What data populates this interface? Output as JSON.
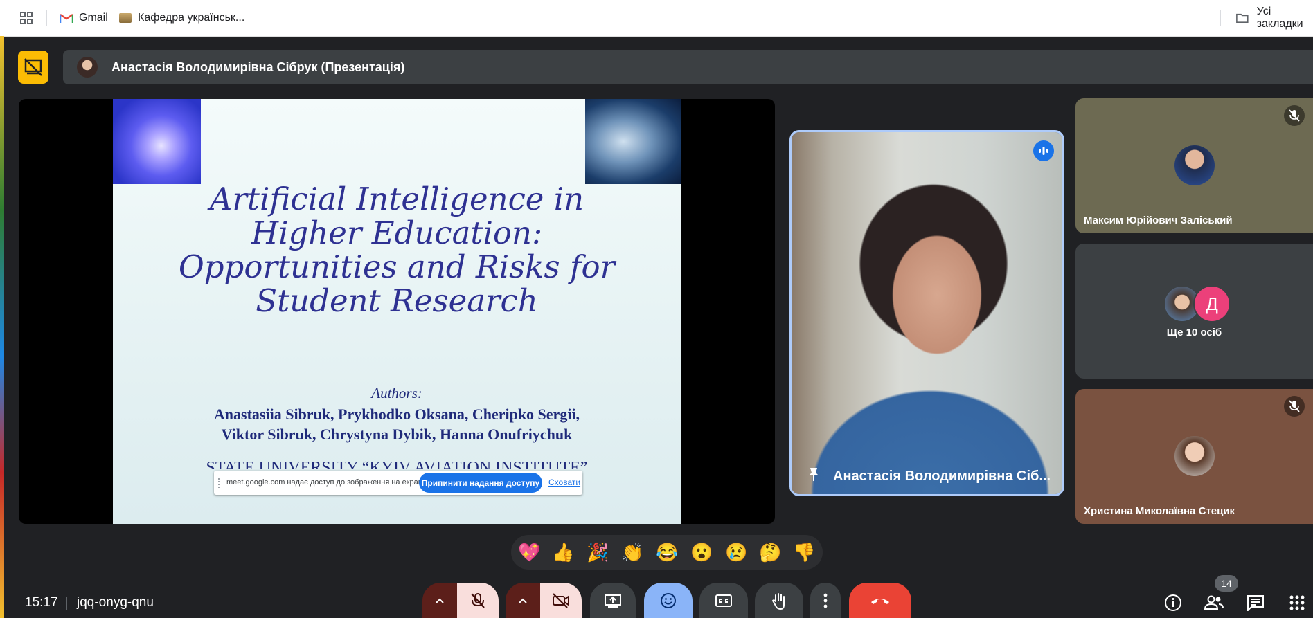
{
  "bookmarks": {
    "gmail": "Gmail",
    "kafedra": "Кафедра українськ...",
    "all_bookmarks": "Усі закладки"
  },
  "presenter": {
    "name": "Анастасія Володимирівна Сібрук (Презентація)"
  },
  "slide": {
    "title_lines": [
      "Artificial Intelligence in",
      "Higher Education:",
      "Opportunities and Risks for",
      "Student Research"
    ],
    "authors_heading": "Authors:",
    "authors_lines": [
      "Anastasiia Sibruk, Prykhodko Oksana, Cheripko Sergii,",
      "Viktor Sibruk, Chrystyna Dybik, Hanna Onufriychuk"
    ],
    "university": "STATE UNIVERSITY “KYIV AVIATION INSTITUTE”"
  },
  "share_notice": {
    "text": "meet.google.com надає доступ до зображення на екрані.",
    "stop_button": "Припинити надання доступу",
    "hide_link": "Сховати"
  },
  "speaker": {
    "name": "Анастасія Володимирівна Сіб..."
  },
  "participants": [
    {
      "name": "Максим Юрійович Заліський",
      "muted": true
    },
    {
      "name": "Ще 10 осіб",
      "extra_initial": "Д"
    },
    {
      "name": "Христина Миколаївна Стецик",
      "muted": true
    }
  ],
  "reactions": [
    "💖",
    "👍",
    "🎉",
    "👏",
    "😂",
    "😮",
    "😢",
    "🤔",
    "👎"
  ],
  "bottom": {
    "time": "15:17",
    "meeting_code": "jqq-onyg-qnu",
    "participant_count": "14"
  },
  "colors": {
    "accent": "#fbbc04",
    "speaker_border": "#aecbfa",
    "end_call": "#ea4335",
    "control_muted": "#f9dedc",
    "control_active": "#8ab4f8"
  }
}
